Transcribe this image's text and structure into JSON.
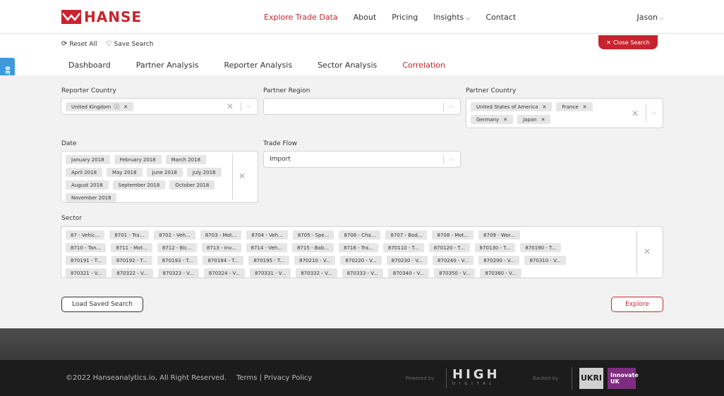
{
  "brand": {
    "name": "HANSE",
    "color": "#c8242f"
  },
  "nav": {
    "items": [
      {
        "label": "Explore Trade Data",
        "active": true
      },
      {
        "label": "About"
      },
      {
        "label": "Pricing"
      },
      {
        "label": "Insights"
      },
      {
        "label": "Contact"
      }
    ],
    "user": "Jason"
  },
  "beta_label": "BETA",
  "toolbar": {
    "reset": "Reset All",
    "save": "Save Search",
    "close": "Close Search"
  },
  "tabs": [
    "Dashboard",
    "Partner Analysis",
    "Reporter Analysis",
    "Sector Analysis",
    "Correlation"
  ],
  "active_tab": "Correlation",
  "form": {
    "reporter_country": {
      "label": "Reporter Country",
      "value": "United Kingdom"
    },
    "partner_region": {
      "label": "Partner Region",
      "value": ""
    },
    "partner_country": {
      "label": "Partner Country",
      "values": [
        "United States of America",
        "France",
        "Germany",
        "Japan"
      ]
    },
    "date": {
      "label": "Date",
      "values": [
        "January 2018",
        "February 2018",
        "March 2018",
        "April 2018",
        "May 2018",
        "June 2018",
        "July 2018",
        "August 2018",
        "September 2018",
        "October 2018",
        "November 2018"
      ]
    },
    "trade_flow": {
      "label": "Trade Flow",
      "value": "Import"
    },
    "sector": {
      "label": "Sector",
      "values": [
        "87 - Vehic...",
        "8701 - Tra...",
        "8702 - Veh...",
        "8703 - Mot...",
        "8704 - Veh...",
        "8705 - Spe...",
        "8706 - Cha...",
        "8707 - Bod...",
        "8708 - Mot...",
        "8709 - Wor...",
        "8710 - Tan...",
        "8711 - Mot...",
        "8712 - Bic...",
        "8713 - Inv...",
        "8714 - Veh...",
        "8715 - Bab...",
        "8716 - Tra...",
        "870110 - T...",
        "870120 - T...",
        "870130 - T...",
        "870190 - T...",
        "870191 - T...",
        "870192 - T...",
        "870193 - T...",
        "870194 - T...",
        "870195 - T...",
        "870210 - V...",
        "870220 - V...",
        "870230 - V...",
        "870240 - V...",
        "870290 - V...",
        "870310 - V...",
        "870321 - V...",
        "870322 - V...",
        "870323 - V...",
        "870324 - V...",
        "870331 - V...",
        "870332 - V...",
        "870333 - V...",
        "870340 - V...",
        "870350 - V...",
        "870360 - V..."
      ]
    },
    "load_button": "Load Saved Search",
    "explore_button": "Explore"
  },
  "footer": {
    "copyright": "©2022 Hanseanalytics.io, All Right Reserved.",
    "terms": "Terms | Privacy Policy",
    "powered_by": "Powered by",
    "high": "HIGH",
    "digital": "DIGITAL",
    "backed_by": "Backed by",
    "ukri": "UKRI",
    "innovate": "Innovate UK"
  }
}
